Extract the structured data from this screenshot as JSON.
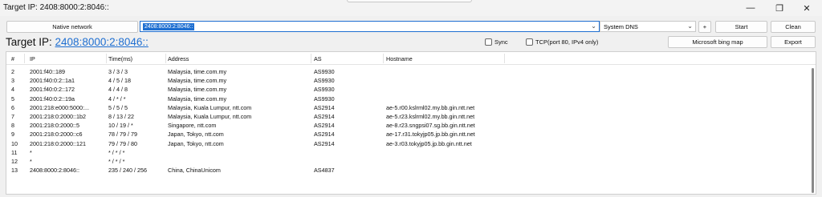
{
  "window": {
    "title": "Target IP: 2408:8000:2:8046::"
  },
  "toolbar": {
    "network_label": "Native network",
    "target_value": "2408:8000:2:8046::",
    "dns_value": "System DNS",
    "plus_label": "+",
    "start_label": "Start",
    "clean_label": "Clean",
    "map_label": "Microsoft bing map",
    "export_label": "Export"
  },
  "header": {
    "target_prefix": "Target IP: ",
    "target_ip": "2408:8000:2:8046::",
    "sync_label": "Sync",
    "tcp_label": "TCP(port 80, IPv4 only)"
  },
  "table": {
    "columns": [
      "#",
      "IP",
      "Time(ms)",
      "Address",
      "AS",
      "Hostname"
    ],
    "rows": [
      {
        "n": "2",
        "ip": "2001:f40::189",
        "time": "3 / 3 / 3",
        "addr": "Malaysia, time.com.my",
        "as": "AS9930",
        "host": ""
      },
      {
        "n": "3",
        "ip": "2001:f40:0:2::1a1",
        "time": "4 / 5 / 18",
        "addr": "Malaysia, time.com.my",
        "as": "AS9930",
        "host": ""
      },
      {
        "n": "4",
        "ip": "2001:f40:0:2::172",
        "time": "4 / 4 / 8",
        "addr": "Malaysia, time.com.my",
        "as": "AS9930",
        "host": ""
      },
      {
        "n": "5",
        "ip": "2001:f40:0:2::19a",
        "time": "4 / * / *",
        "addr": "Malaysia, time.com.my",
        "as": "AS9930",
        "host": ""
      },
      {
        "n": "6",
        "ip": "2001:218:e000:5000:...",
        "time": "5 / 5 / 5",
        "addr": "Malaysia, Kuala Lumpur, ntt.com",
        "as": "AS2914",
        "host": "ae-5.r00.kslrml02.my.bb.gin.ntt.net"
      },
      {
        "n": "7",
        "ip": "2001:218:0:2000::1b2",
        "time": "8 / 13 / 22",
        "addr": "Malaysia, Kuala Lumpur, ntt.com",
        "as": "AS2914",
        "host": "ae-5.r23.kslrml02.my.bb.gin.ntt.net"
      },
      {
        "n": "8",
        "ip": "2001:218:0:2000::5",
        "time": "10 / 19 / *",
        "addr": "Singapore, ntt.com",
        "as": "AS2914",
        "host": "ae-8.r23.sngpsi07.sg.bb.gin.ntt.net"
      },
      {
        "n": "9",
        "ip": "2001:218:0:2000::c6",
        "time": "78 / 79 / 79",
        "addr": "Japan, Tokyo, ntt.com",
        "as": "AS2914",
        "host": "ae-17.r31.tokyjp05.jp.bb.gin.ntt.net"
      },
      {
        "n": "10",
        "ip": "2001:218:0:2000::121",
        "time": "79 / 79 / 80",
        "addr": "Japan, Tokyo, ntt.com",
        "as": "AS2914",
        "host": "ae-3.r03.tokyjp05.jp.bb.gin.ntt.net"
      },
      {
        "n": "11",
        "ip": "*",
        "time": "* / * / *",
        "addr": "",
        "as": "",
        "host": ""
      },
      {
        "n": "12",
        "ip": "*",
        "time": "* / * / *",
        "addr": "",
        "as": "",
        "host": ""
      },
      {
        "n": "13",
        "ip": "2408:8000:2:8046::",
        "time": "235 / 240 / 256",
        "addr": "China, ChinaUnicom",
        "as": "AS4837",
        "host": ""
      }
    ]
  }
}
